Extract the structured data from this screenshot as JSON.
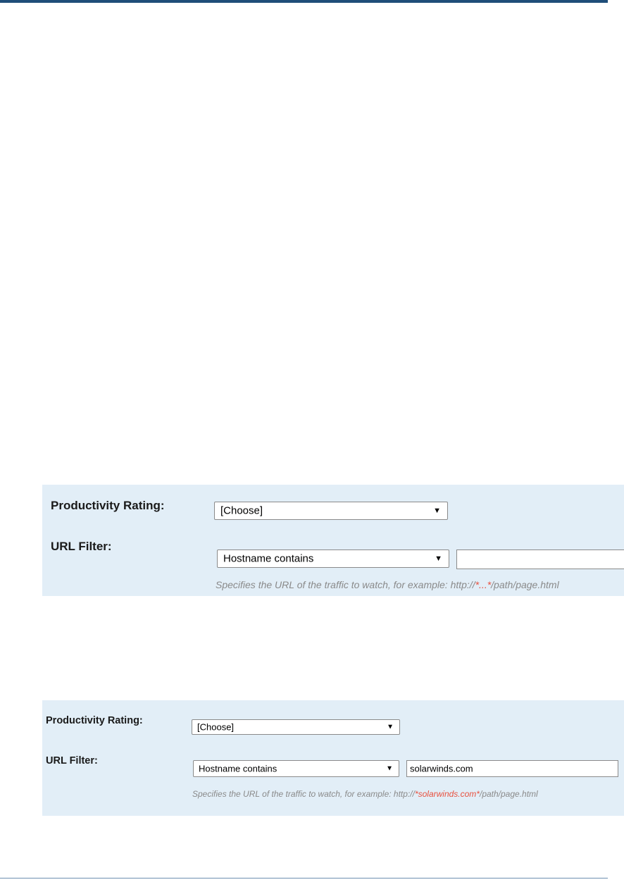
{
  "example_before": {
    "productivity_label": "Productivity Rating:",
    "productivity_value": "[Choose]",
    "url_filter_label": "URL Filter:",
    "url_filter_mode": "Hostname contains",
    "url_filter_value": "",
    "hint_prefix": "Specifies the URL of the traffic to watch, for example: http://",
    "hint_highlight": "*...*",
    "hint_suffix": "/path/page.html"
  },
  "example_after": {
    "productivity_label": "Productivity Rating:",
    "productivity_value": "[Choose]",
    "url_filter_label": "URL Filter:",
    "url_filter_mode": "Hostname contains",
    "url_filter_value": "solarwinds.com",
    "hint_prefix": "Specifies the URL of the traffic to watch, for example: http://",
    "hint_highlight": "*solarwinds.com*",
    "hint_suffix": "/path/page.html"
  },
  "icons": {
    "dropdown_arrow": "▼"
  },
  "colors": {
    "panel_background": "#e2eef7",
    "hint_text": "#8a8a8a",
    "hint_highlight": "#e8503e",
    "header_rule": "#1f4e79"
  }
}
